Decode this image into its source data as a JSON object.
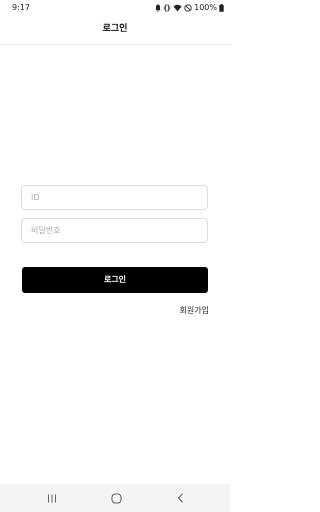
{
  "status_bar": {
    "time": "9:17",
    "battery": "100%",
    "icons": [
      "notification-icon",
      "vibrate-icon",
      "wifi-icon",
      "do-not-disturb-icon",
      "battery-icon"
    ]
  },
  "header": {
    "title": "로그인"
  },
  "form": {
    "id_placeholder": "ID",
    "id_value": "",
    "password_placeholder": "비밀번호",
    "password_value": "",
    "login_label": "로그인",
    "signup_label": "회원가입"
  },
  "nav_bar": {
    "icons": [
      "recent-apps-icon",
      "home-icon",
      "back-icon"
    ]
  },
  "colors": {
    "primary_button": "#000000",
    "background": "#ffffff",
    "border": "#dcdcdc"
  }
}
